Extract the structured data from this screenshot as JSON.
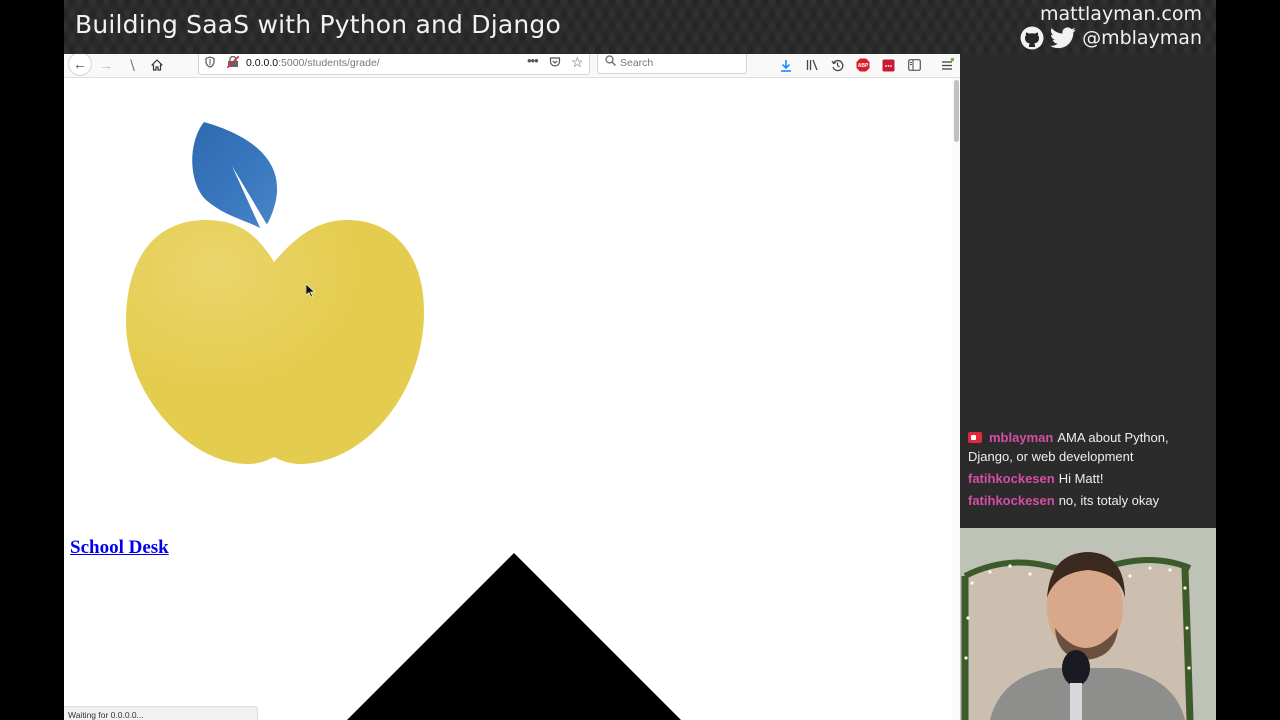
{
  "stream": {
    "title": "Building SaaS with Python and Django",
    "site": "mattlayman.com",
    "handle": "@mblayman"
  },
  "browser": {
    "url_host": "0.0.0.0",
    "url_path": ":5000/students/grade/",
    "search_placeholder": "Search",
    "status_text": "Waiting for 0.0.0.0...",
    "toolbar_icons": [
      "downloads-icon",
      "library-icon",
      "history-icon",
      "adblock-plus-icon",
      "extension-icon",
      "sidebar-icon",
      "menu-icon"
    ]
  },
  "page": {
    "link_label": "School Desk",
    "apple_colors": {
      "body": "#e4cc4e",
      "leaf": "#3470b6"
    }
  },
  "chat": {
    "messages": [
      {
        "user": "mblayman",
        "text": "AMA about Python, Django, or web development",
        "broadcaster": true
      },
      {
        "user": "fatihkockesen",
        "text": "Hi Matt!"
      },
      {
        "user": "fatihkockesen",
        "text": "no, its totaly okay"
      }
    ]
  },
  "webcam": {
    "label": "Streamer webcam"
  }
}
